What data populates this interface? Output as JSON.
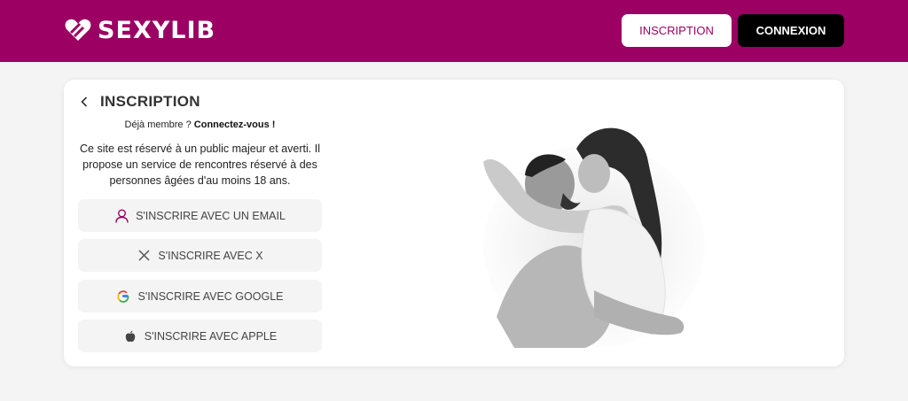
{
  "header": {
    "logo_text": "SEXYLIB",
    "signup_label": "INSCRIPTION",
    "login_label": "CONNEXION"
  },
  "colors": {
    "brand": "#9b0062",
    "background": "#f4f4f4",
    "card": "#ffffff",
    "option_bg": "#f4f4f4"
  },
  "card": {
    "title": "INSCRIPTION",
    "member_prefix": "Déjà membre ? ",
    "member_link": "Connectez-vous !",
    "notice": "Ce site est réservé à un public majeur et averti. Il propose un service de rencontres réservé à des personnes âgées d'au moins 18 ans.",
    "options": [
      {
        "label": "S'INSCRIRE AVEC UN EMAIL",
        "icon": "user-icon"
      },
      {
        "label": "S'INSCRIRE AVEC X",
        "icon": "x-logo-icon"
      },
      {
        "label": "S'INSCRIRE AVEC GOOGLE",
        "icon": "google-logo-icon"
      },
      {
        "label": "S'INSCRIRE AVEC APPLE",
        "icon": "apple-logo-icon"
      }
    ],
    "image": "couple-photo"
  }
}
